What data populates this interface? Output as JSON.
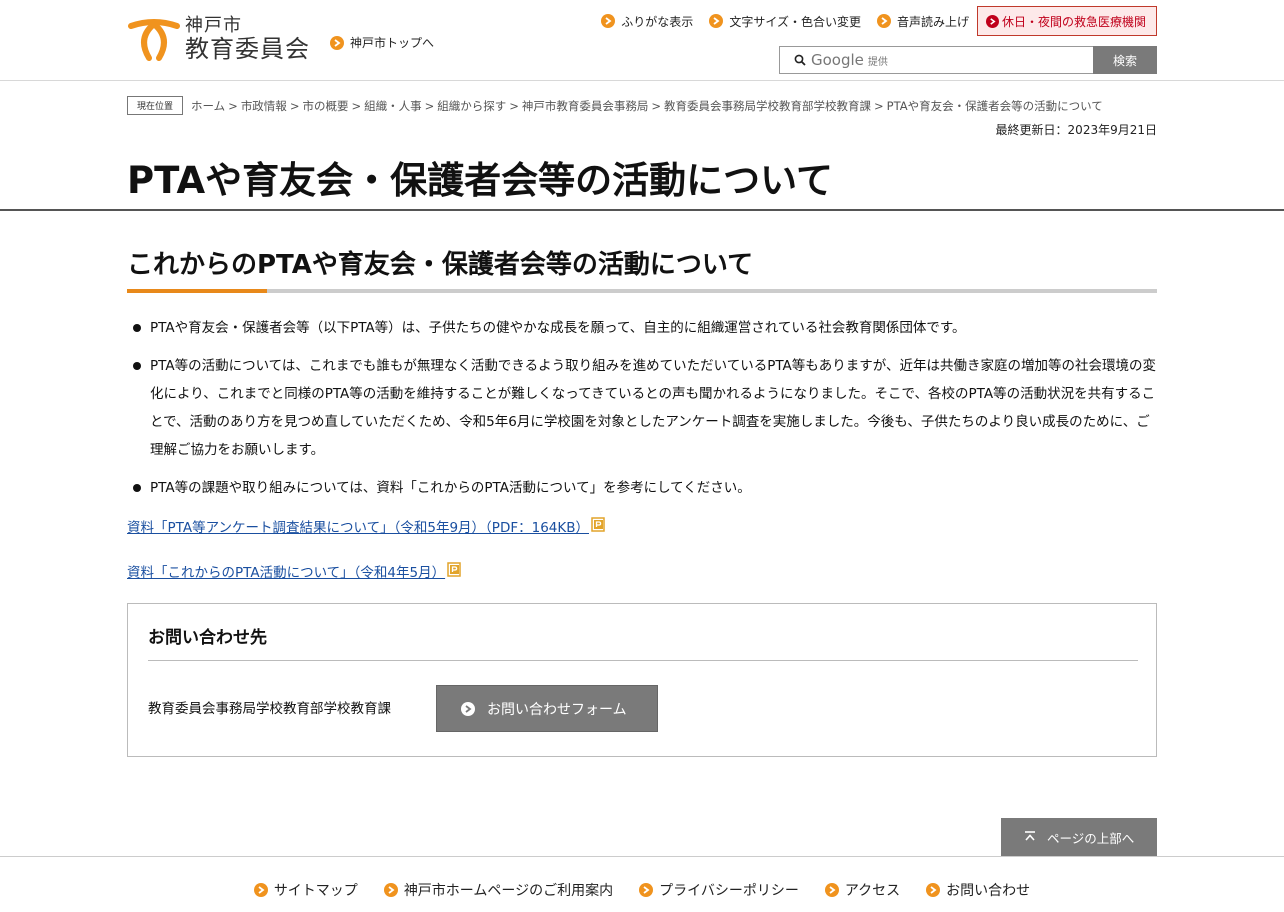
{
  "header": {
    "logo_city": "神戸市",
    "logo_board": "教育委員会",
    "kobe_top_label": "神戸市トップへ",
    "util_links": [
      "ふりがな表示",
      "文字サイズ・色合い変更",
      "音声読み上げ"
    ],
    "emergency_label": "休日・夜間の救急医療機関",
    "search_brand": "Google",
    "search_provided": "提供",
    "search_button": "検索"
  },
  "breadcrumb": {
    "label": "現在位置",
    "items": [
      "ホーム",
      "市政情報",
      "市の概要",
      "組織・人事",
      "組織から探す",
      "神戸市教育委員会事務局",
      "教育委員会事務局学校教育部学校教育課",
      "PTAや育友会・保護者会等の活動について"
    ],
    "separator": ">"
  },
  "updated": "最終更新日：2023年9月21日",
  "page_title": "PTAや育友会・保護者会等の活動について",
  "section_heading": "これからのPTAや育友会・保護者会等の活動について",
  "bullets": [
    "PTAや育友会・保護者会等（以下PTA等）は、子供たちの健やかな成長を願って、自主的に組織運営されている社会教育関係団体です。",
    "PTA等の活動については、これまでも誰もが無理なく活動できるよう取り組みを進めていただいているPTA等もありますが、近年は共働き家庭の増加等の社会環境の変化により、これまでと同様のPTA等の活動を維持することが難しくなってきているとの声も聞かれるようになりました。そこで、各校のPTA等の活動状況を共有することで、活動のあり方を見つめ直していただくため、令和5年6月に学校園を対象としたアンケート調査を実施しました。今後も、子供たちのより良い成長のために、ご理解ご協力をお願いします。",
    "PTA等の課題や取り組みについては、資料「これからのPTA活動について」を参考にしてください。"
  ],
  "links": [
    "資料「PTA等アンケート調査結果について」（令和5年9月）（PDF：164KB）",
    "資料「これからのPTA活動について」（令和4年5月）"
  ],
  "contact": {
    "title": "お問い合わせ先",
    "department": "教育委員会事務局学校教育部学校教育課",
    "form_button": "お問い合わせフォーム"
  },
  "to_top": "ページの上部へ",
  "footer_links": [
    "サイトマップ",
    "神戸市ホームページのご利用案内",
    "プライバシーポリシー",
    "アクセス",
    "お問い合わせ"
  ],
  "colors": {
    "accent_orange": "#f0931e",
    "link_blue": "#1a4fa0",
    "emergency_red": "#c0001b",
    "button_gray": "#7a7a7a"
  }
}
